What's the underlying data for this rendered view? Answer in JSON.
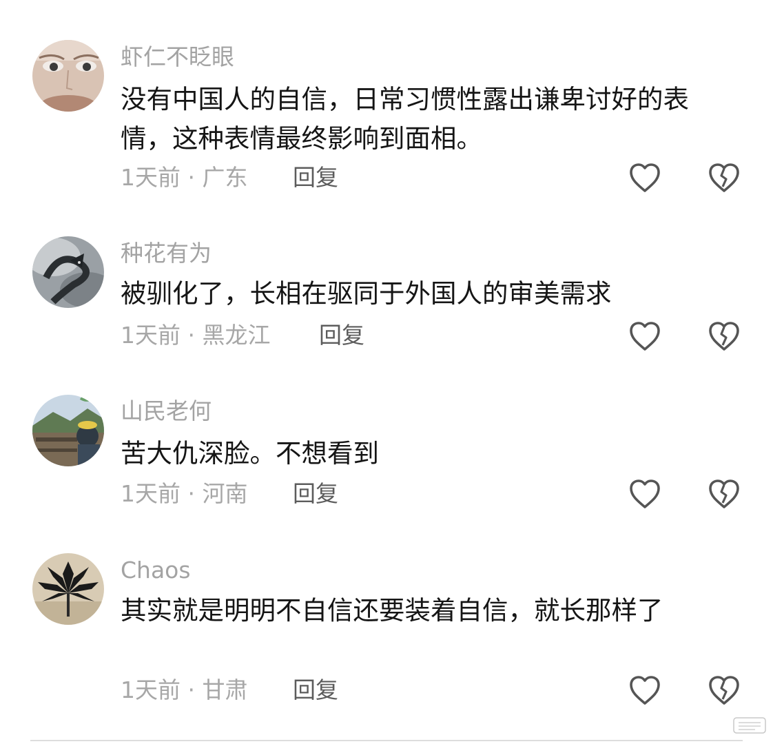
{
  "comments": [
    {
      "username": "虾仁不眨眼",
      "text": "没有中国人的自信，日常习惯性露出谦卑讨好的表情，这种表情最终影响到面相。",
      "meta": "1天前 · 广东",
      "reply_label": "回复",
      "like_icon": "heart-outline-icon",
      "dislike_icon": "broken-heart-icon"
    },
    {
      "username": "种花有为",
      "text": "被驯化了，长相在驱同于外国人的审美需求",
      "meta": "1天前 · 黑龙江",
      "reply_label": "回复",
      "like_icon": "heart-outline-icon",
      "dislike_icon": "broken-heart-icon"
    },
    {
      "username": "山民老何",
      "text": "苦大仇深脸。不想看到",
      "meta": "1天前 · 河南",
      "reply_label": "回复",
      "like_icon": "heart-outline-icon",
      "dislike_icon": "broken-heart-icon"
    },
    {
      "username": "Chaos",
      "text": "其实就是明明不自信还要装着自信，就长那样了",
      "meta": "1天前 · 甘肃",
      "reply_label": "回复",
      "like_icon": "heart-outline-icon",
      "dislike_icon": "broken-heart-icon"
    }
  ],
  "colors": {
    "username": "#a3a3a3",
    "text": "#151515",
    "meta": "#a7a7a7",
    "reply": "#5c5c5c",
    "icon": "#555555"
  }
}
